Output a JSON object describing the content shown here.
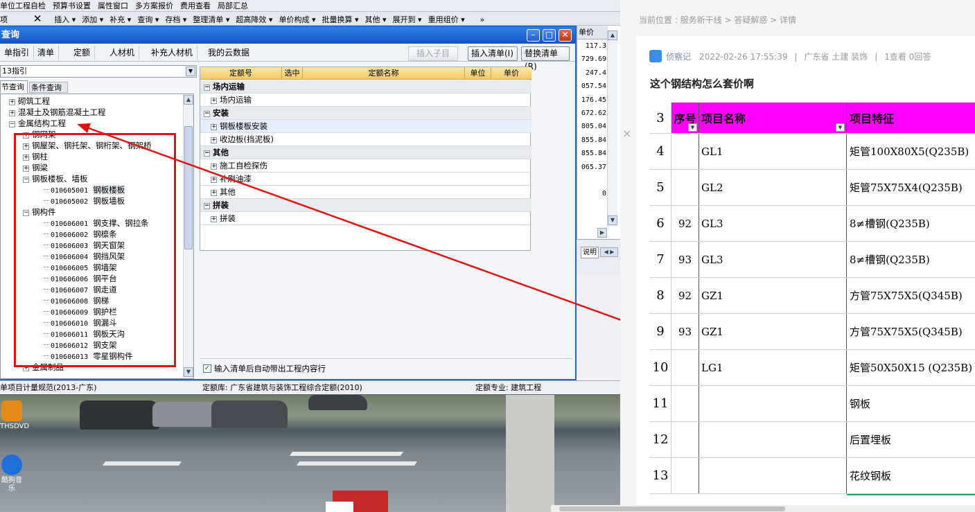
{
  "bg_app": {
    "toolbar1": [
      "单位工程自检",
      "预算书设置",
      "属性窗口",
      "多方案报价",
      "费用查看",
      "局部汇总"
    ],
    "toolbar2": {
      "left_label": "项",
      "close": "✕",
      "items": [
        "插入 ▾",
        "添加 ▾",
        "补充 ▾",
        "查询 ▾",
        "存档 ▾",
        "整理清单 ▾",
        "超高降效 ▾",
        "单价构成 ▾",
        "批量换算 ▾",
        "其他 ▾",
        "展开到 ▾",
        "重用组价 ▾"
      ],
      "more": "»"
    },
    "right_col_header": "单价",
    "right_values": [
      "117.3",
      "729.69",
      "247.4",
      "057.54",
      "176.45",
      "672.62",
      "805.04",
      "855.84",
      "855.84",
      "065.37",
      "",
      "0"
    ],
    "panel_tab": "说明",
    "status": {
      "left": "单项目计量规范(2013-广东)",
      "mid": "定额库: 广东省建筑与装饰工程综合定额(2010)",
      "right": "定额专业: 建筑工程"
    }
  },
  "desktop_icons": [
    {
      "label": "THSDVD",
      "color": "#e58a1a"
    },
    {
      "label": "酷狗音乐",
      "color": "#1f6fd8"
    }
  ],
  "dialog": {
    "title": "查询",
    "tabs": [
      "单指引",
      "清单",
      "定额",
      "人材机",
      "补充人材机",
      "我的云数据"
    ],
    "buttons": {
      "insert_child": "插入子目",
      "insert_list": "插入清单(I)",
      "replace_list": "替换清单(R)"
    },
    "dropdown_value": "13指引",
    "subtabs": [
      "节查询",
      "条件查询"
    ],
    "tree": [
      {
        "level": 0,
        "sign": "+",
        "text": "砌筑工程"
      },
      {
        "level": 0,
        "sign": "+",
        "text": "混凝土及钢筋混凝土工程"
      },
      {
        "level": 0,
        "sign": "−",
        "text": "金属结构工程"
      },
      {
        "level": 1,
        "sign": "+",
        "text": "钢网架"
      },
      {
        "level": 1,
        "sign": "+",
        "text": "钢屋架、钢托架、钢桁架、钢架桥"
      },
      {
        "level": 1,
        "sign": "+",
        "text": "钢柱"
      },
      {
        "level": 1,
        "sign": "+",
        "text": "钢梁"
      },
      {
        "level": 1,
        "sign": "−",
        "text": "钢板楼板、墙板"
      },
      {
        "level": 2,
        "code": "010605001",
        "text": "钢板楼板",
        "selected": true
      },
      {
        "level": 2,
        "code": "010605002",
        "text": "钢板墙板"
      },
      {
        "level": 1,
        "sign": "−",
        "text": "钢构件"
      },
      {
        "level": 2,
        "code": "010606001",
        "text": "钢支撑、钢拉条"
      },
      {
        "level": 2,
        "code": "010606002",
        "text": "钢檩条"
      },
      {
        "level": 2,
        "code": "010606003",
        "text": "钢天窗架"
      },
      {
        "level": 2,
        "code": "010606004",
        "text": "钢挡风架"
      },
      {
        "level": 2,
        "code": "010606005",
        "text": "钢墙架"
      },
      {
        "level": 2,
        "code": "010606006",
        "text": "钢平台"
      },
      {
        "level": 2,
        "code": "010606007",
        "text": "钢走道"
      },
      {
        "level": 2,
        "code": "010606008",
        "text": "钢梯"
      },
      {
        "level": 2,
        "code": "010606009",
        "text": "钢护栏"
      },
      {
        "level": 2,
        "code": "010606010",
        "text": "钢漏斗"
      },
      {
        "level": 2,
        "code": "010606011",
        "text": "钢板天沟"
      },
      {
        "level": 2,
        "code": "010606012",
        "text": "钢支架"
      },
      {
        "level": 2,
        "code": "010606013",
        "text": "零星钢构件"
      },
      {
        "level": 1,
        "sign": "+",
        "text": "金属制品"
      }
    ],
    "grid_headers": [
      "定额号",
      "选中",
      "定额名称",
      "单位",
      "单价"
    ],
    "grid_rows": [
      {
        "type": "grp",
        "text": "场内运输"
      },
      {
        "type": "sub",
        "text": "场内运输"
      },
      {
        "type": "grp",
        "text": "安装"
      },
      {
        "type": "sub",
        "text": "钢板楼板安装",
        "hl": true
      },
      {
        "type": "sub",
        "text": "收边板(挡泥板)"
      },
      {
        "type": "grp",
        "text": "其他"
      },
      {
        "type": "sub",
        "text": "施工自检探伤"
      },
      {
        "type": "sub",
        "text": "补刷油漆"
      },
      {
        "type": "sub",
        "text": "其他"
      },
      {
        "type": "grp",
        "text": "拼装"
      },
      {
        "type": "sub",
        "text": "拼装"
      }
    ],
    "checkbox_label": "输入清单后自动带出工程内容行",
    "checkbox_checked": true
  },
  "web": {
    "breadcrumb": "当前位置 : 服务新干线 > 答疑解惑 > 详情",
    "user": "侦察记",
    "datetime": "2022-02-26 17:55:39",
    "region": "广东省",
    "tags": "土建 装饰",
    "stats": "1查看  0回答",
    "question_title": "这个钢结构怎么套价啊",
    "close_mark": "×",
    "sheet_header": {
      "rn": "3",
      "c1": "序号",
      "c2": "项目名称",
      "c3": "项目特征"
    },
    "sheet_rows": [
      {
        "rn": "4",
        "c1": "",
        "c2": "GL1",
        "c3": "矩管100X80X5(Q235B)"
      },
      {
        "rn": "5",
        "c1": "",
        "c2": "GL2",
        "c3": "矩管75X75X4(Q235B)"
      },
      {
        "rn": "6",
        "c1": "92",
        "c2": "GL3",
        "c3": "8≠槽钢(Q235B)"
      },
      {
        "rn": "7",
        "c1": "93",
        "c2": "GL3",
        "c3": "8≠槽钢(Q235B)"
      },
      {
        "rn": "8",
        "c1": "92",
        "c2": "GZ1",
        "c3": "方管75X75X5(Q345B)"
      },
      {
        "rn": "9",
        "c1": "93",
        "c2": "GZ1",
        "c3": "方管75X75X5(Q345B)"
      },
      {
        "rn": "10",
        "c1": "",
        "c2": "LG1",
        "c3": "矩管50X50X15 (Q235B)"
      },
      {
        "rn": "11",
        "c1": "",
        "c2": "",
        "c3": "钢板"
      },
      {
        "rn": "12",
        "c1": "",
        "c2": "",
        "c3": "后置埋板"
      },
      {
        "rn": "13",
        "c1": "",
        "c2": "",
        "c3": "花纹钢板"
      }
    ]
  },
  "colors": {
    "title_bar": "#1d6bd1",
    "annotation": "#e01313",
    "sheet_header": "#ff00ff",
    "grid_header": "#f6c867"
  }
}
